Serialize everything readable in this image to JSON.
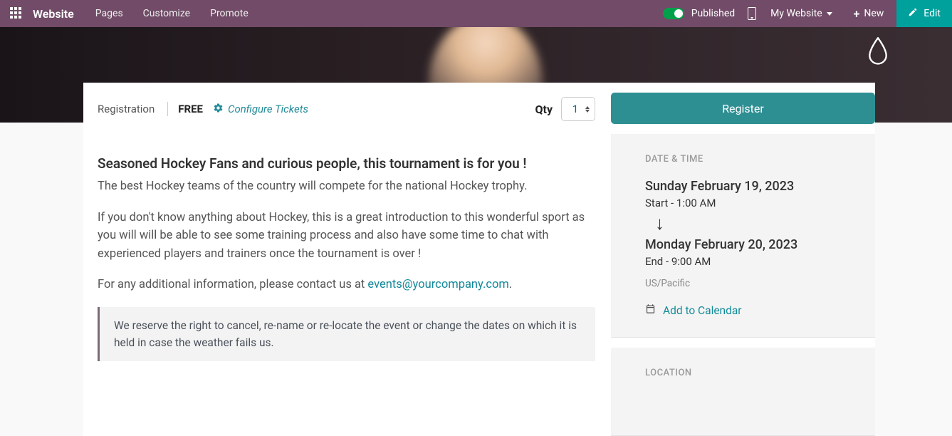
{
  "topbar": {
    "brand": "Website",
    "menu": [
      "Pages",
      "Customize",
      "Promote"
    ],
    "published": "Published",
    "my_website": "My Website",
    "new": "New",
    "edit": "Edit"
  },
  "registration": {
    "label": "Registration",
    "price": "FREE",
    "configure": "Configure Tickets",
    "qty_label": "Qty",
    "qty_value": "1"
  },
  "content": {
    "headline": "Seasoned Hockey Fans and curious people, this tournament is for you !",
    "p1": "The best Hockey teams of the country will compete for the national Hockey trophy.",
    "p2": "If you don't know anything about Hockey, this is a great introduction to this wonderful sport as you will will be able to see some training process and also have some time to chat with experienced players and trainers once the tournament is over !",
    "p3_pre": "For any additional information, please contact us at ",
    "p3_link": "events@yourcompany.com",
    "p3_post": ".",
    "disclaimer": "We reserve the right to cancel, re-name or re-locate the event or change the dates on which it is held in case the weather fails us."
  },
  "sidebar": {
    "register": "Register",
    "dt_heading": "DATE & TIME",
    "start_date": "Sunday February 19, 2023",
    "start_time": "Start - 1:00 AM",
    "end_date": "Monday February 20, 2023",
    "end_time": "End - 9:00 AM",
    "timezone": "US/Pacific",
    "add_cal": "Add to Calendar",
    "loc_heading": "LOCATION"
  }
}
